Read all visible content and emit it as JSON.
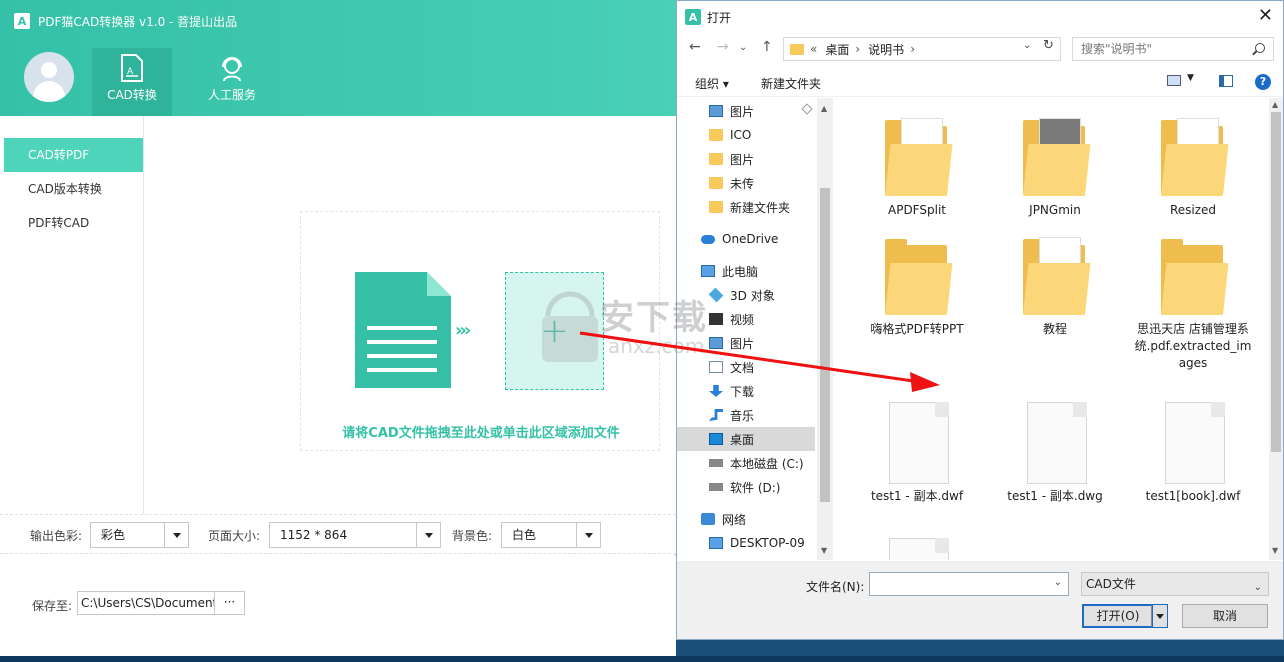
{
  "app": {
    "title": "PDF猫CAD转换器 v1.0 - 菩提山出品",
    "logo_letter": "A",
    "nav_tabs": [
      {
        "label": "CAD转换",
        "active": true
      },
      {
        "label": "人工服务",
        "active": false
      }
    ],
    "menu": [
      {
        "label": "CAD转PDF",
        "active": true
      },
      {
        "label": "CAD版本转换",
        "active": false
      },
      {
        "label": "PDF转CAD",
        "active": false
      }
    ],
    "drop_hint": "请将CAD文件拖拽至此处或单击此区域添加文件",
    "options": {
      "color_label": "输出色彩:",
      "color_value": "彩色",
      "page_size_label": "页面大小:",
      "page_size_value": "1152 * 864",
      "bg_label": "背景色:",
      "bg_value": "白色"
    },
    "save": {
      "label": "保存至:",
      "path": "C:\\Users\\CS\\Documents",
      "browse": "···"
    }
  },
  "dialog": {
    "title": "打开",
    "breadcrumb": [
      "«",
      "桌面",
      "›",
      "说明书",
      "›"
    ],
    "search_placeholder": "搜索\"说明书\"",
    "toolbar": {
      "organize": "组织 ▾",
      "new_folder": "新建文件夹"
    },
    "nav_items": [
      {
        "label": "图片",
        "icon": "pic"
      },
      {
        "label": "ICO",
        "icon": "folder"
      },
      {
        "label": "图片",
        "icon": "folder"
      },
      {
        "label": "未传",
        "icon": "folder"
      },
      {
        "label": "新建文件夹",
        "icon": "folder"
      },
      {
        "label": "OneDrive",
        "icon": "cloud"
      },
      {
        "label": "此电脑",
        "icon": "pc"
      },
      {
        "label": "3D 对象",
        "icon": "3d"
      },
      {
        "label": "视频",
        "icon": "video"
      },
      {
        "label": "图片",
        "icon": "pic"
      },
      {
        "label": "文档",
        "icon": "doc"
      },
      {
        "label": "下载",
        "icon": "dl"
      },
      {
        "label": "音乐",
        "icon": "music"
      },
      {
        "label": "桌面",
        "icon": "desk"
      },
      {
        "label": "本地磁盘 (C:)",
        "icon": "drive"
      },
      {
        "label": "软件 (D:)",
        "icon": "drive"
      },
      {
        "label": "网络",
        "icon": "net"
      },
      {
        "label": "DESKTOP-09",
        "icon": "pc"
      }
    ],
    "files": [
      {
        "name": "APDFSplit",
        "kind": "folder"
      },
      {
        "name": "JPNGmin",
        "kind": "folder"
      },
      {
        "name": "Resized",
        "kind": "folder"
      },
      {
        "name": "嗨格式PDF转PPT",
        "kind": "folder"
      },
      {
        "name": "教程",
        "kind": "folder"
      },
      {
        "name": "思迅天店 店铺管理系统.pdf.extracted_images",
        "kind": "folder"
      },
      {
        "name": "test1 - 副本.dwf",
        "kind": "file"
      },
      {
        "name": "test1 - 副本.dwg",
        "kind": "file"
      },
      {
        "name": "test1[book].dwf",
        "kind": "file"
      }
    ],
    "filename_label": "文件名(N):",
    "filename_value": "",
    "filetype": "CAD文件",
    "open_label": "打开(O)",
    "cancel_label": "取消"
  },
  "watermark": {
    "text": "安下载",
    "sub": "anxz.com"
  }
}
